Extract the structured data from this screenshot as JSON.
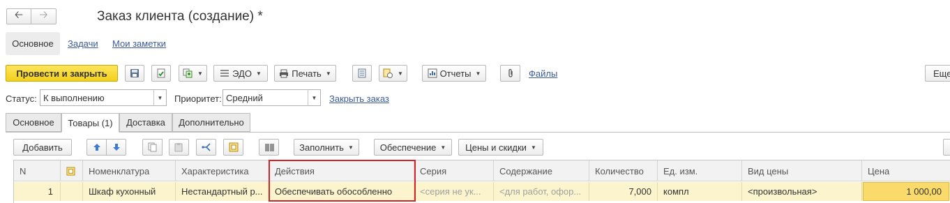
{
  "window": {
    "title": "Заказ клиента (создание) *"
  },
  "nav_tabs": {
    "main": "Основное",
    "tasks": "Задачи",
    "notes": "Мои заметки"
  },
  "toolbar": {
    "post_close": "Провести и закрыть",
    "edo": "ЭДО",
    "print": "Печать",
    "reports": "Отчеты",
    "files": "Файлы",
    "more": "Еще"
  },
  "status_row": {
    "status_label": "Статус:",
    "status_value": "К выполнению",
    "priority_label": "Приоритет:",
    "priority_value": "Средний",
    "close_order": "Закрыть заказ"
  },
  "tabs": [
    "Основное",
    "Товары (1)",
    "Доставка",
    "Дополнительно"
  ],
  "table_toolbar": {
    "add": "Добавить",
    "fill": "Заполнить",
    "provision": "Обеспечение",
    "prices": "Цены и скидки"
  },
  "columns": [
    "N",
    "",
    "Номенклатура",
    "Характеристика",
    "Действия",
    "Серия",
    "Содержание",
    "Количество",
    "Ед. изм.",
    "Вид цены",
    "Цена"
  ],
  "rows": [
    {
      "n": "1",
      "item": "Шкаф кухонный",
      "characteristic": "Нестандартный р...",
      "action": "Обеспечивать обособленно",
      "series": "<серия не ук...",
      "content": "<для работ, офор...",
      "quantity": "7,000",
      "unit": "компл",
      "price_type": "<произвольная>",
      "price": "1 000,00"
    }
  ],
  "colors": {
    "accent_yellow": "#f5d61f",
    "highlight_red": "#d0262a",
    "row_selected": "#fbf4cc",
    "link": "#3a5a9a"
  }
}
